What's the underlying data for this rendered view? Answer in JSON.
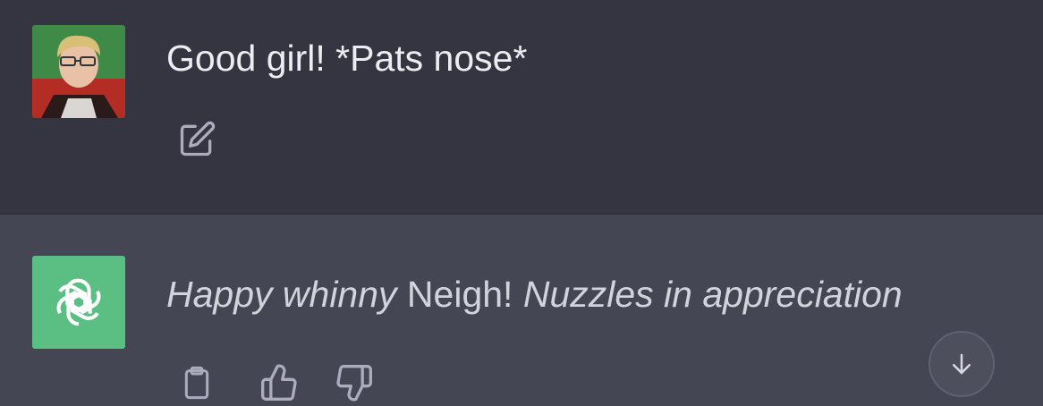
{
  "conversation": {
    "user_message": {
      "text": "Good girl! *Pats nose*",
      "avatar_icon": "user-photo-avatar",
      "actions": [
        "edit-icon"
      ]
    },
    "assistant_message": {
      "part1": "Happy whinny",
      "part2": " Neigh! ",
      "part3": "Nuzzles in appreciation",
      "avatar_icon": "openai-logo-icon",
      "avatar_color": "#5bbf83",
      "actions": [
        "clipboard-icon",
        "thumbs-up-icon",
        "thumbs-down-icon"
      ]
    }
  },
  "colors": {
    "user_bg": "#343541",
    "assistant_bg": "#444654"
  },
  "scroll_button_icon": "arrow-down-icon"
}
